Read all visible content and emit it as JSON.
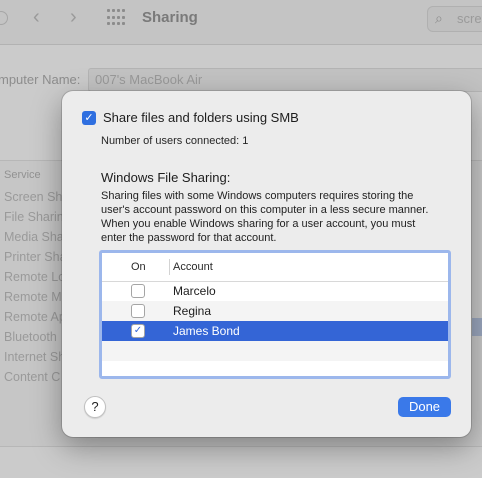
{
  "background": {
    "window_title": "Sharing",
    "search_text": "scree",
    "computer_name_label": "mputer Name:",
    "computer_name_value": "007's MacBook Air",
    "service_header": "Service",
    "services": [
      "Screen Sh",
      "File Sharin",
      "Media Sha",
      "Printer Sha",
      "Remote Lo",
      "Remote M",
      "Remote Ap",
      "Bluetooth",
      "Internet Sh",
      "Content C"
    ]
  },
  "dialog": {
    "smb_checkbox_label": "Share files and folders using SMB",
    "smb_checked": true,
    "users_connected": "Number of users connected: 1",
    "wfs_heading": "Windows File Sharing:",
    "wfs_description": "Sharing files with some Windows computers requires storing the user's account password on this computer in a less secure manner. When you enable Windows sharing for a user account, you must enter the password for that account.",
    "table": {
      "col_on": "On",
      "col_account": "Account",
      "rows": [
        {
          "account": "Marcelo",
          "on": false,
          "selected": false
        },
        {
          "account": "Regina",
          "on": false,
          "selected": false
        },
        {
          "account": "James Bond",
          "on": true,
          "selected": true
        }
      ]
    },
    "help_label": "?",
    "done_label": "Done"
  },
  "colors": {
    "accent": "#3a79e9",
    "selection": "#3465d6"
  }
}
